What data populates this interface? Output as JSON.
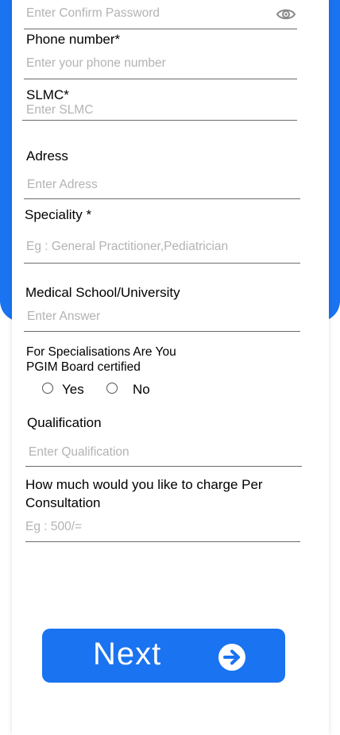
{
  "colors": {
    "accent": "#1a73f0",
    "placeholder": "#b3b3b3",
    "text": "#000000",
    "underline": "#6b6b6b"
  },
  "form": {
    "confirm_password": {
      "placeholder": "Enter Confirm Password",
      "toggle_icon": "eye-icon"
    },
    "phone": {
      "label": "Phone number*",
      "placeholder": "Enter your phone number"
    },
    "slmc": {
      "label": "SLMC*",
      "placeholder": "Enter SLMC"
    },
    "address": {
      "label": "Adress",
      "placeholder": "Enter Adress"
    },
    "speciality": {
      "label": "Speciality *",
      "placeholder": "Eg : General Practitioner,Pediatrician"
    },
    "medical_school": {
      "label": "Medical School/University",
      "placeholder": "Enter Answer"
    },
    "pgim": {
      "label_line1": "For Specialisations Are You",
      "label_line2": "PGIM Board certified",
      "options": [
        "Yes",
        "No"
      ]
    },
    "qualification": {
      "label": "Qualification",
      "placeholder": "Enter Qualification"
    },
    "charge": {
      "label_line1": "How much would you like to charge Per",
      "label_line2": "Consultation",
      "placeholder": "Eg : 500/="
    }
  },
  "next_button": {
    "label": "Next",
    "icon": "arrow-right-circle-icon"
  }
}
